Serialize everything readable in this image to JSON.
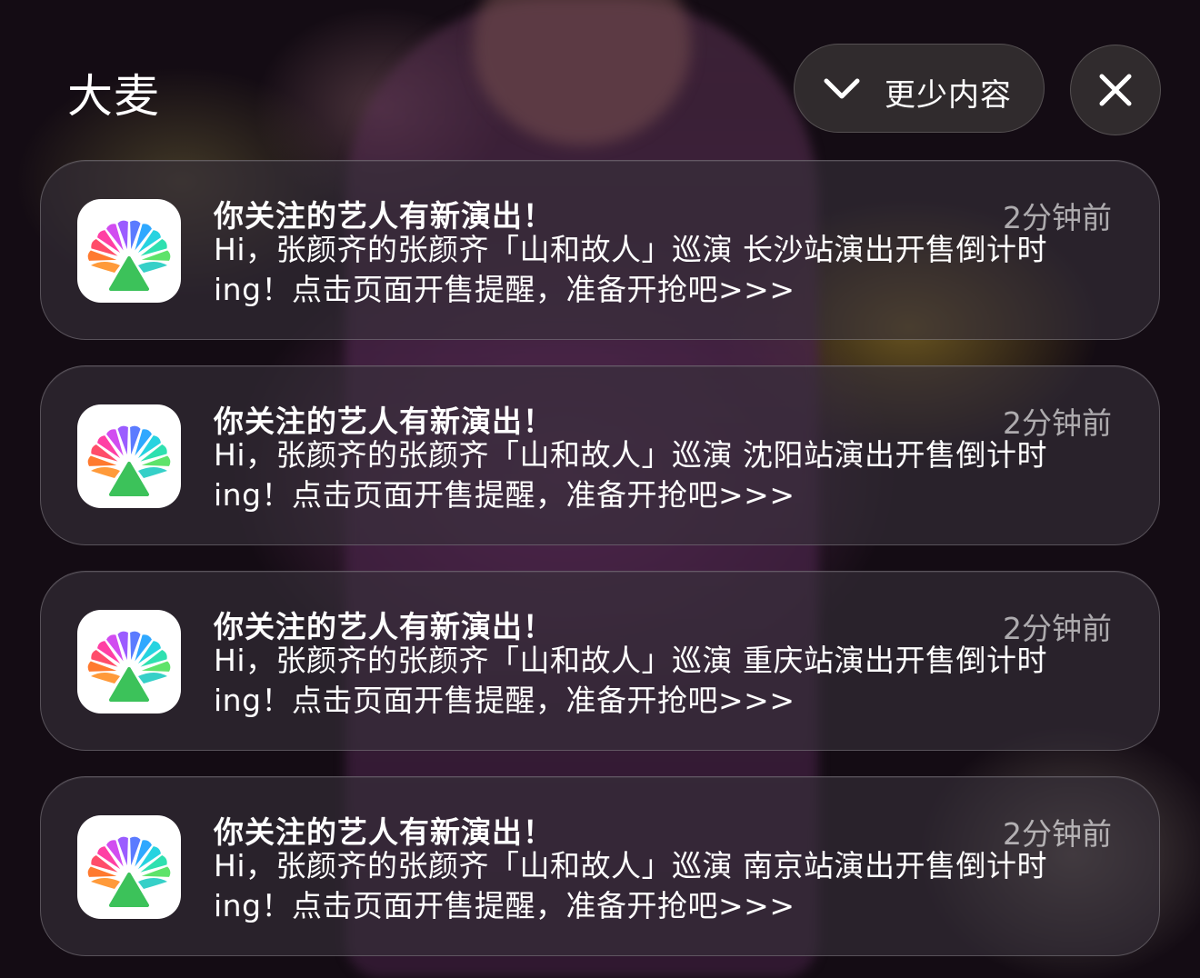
{
  "header": {
    "app_name": "大麦",
    "show_less_label": "更少内容",
    "show_less_icon": "chevron-down-icon",
    "close_icon": "close-icon"
  },
  "notifications": [
    {
      "title": "你关注的艺人有新演出！",
      "time": "2分钟前",
      "body_line1": "Hi，张颜齐的张颜齐「山和故人」巡演 长沙站演出开售倒计时",
      "body_line2": "ing！点击页面开售提醒，准备开抢吧>>>"
    },
    {
      "title": "你关注的艺人有新演出！",
      "time": "2分钟前",
      "body_line1": "Hi，张颜齐的张颜齐「山和故人」巡演 沈阳站演出开售倒计时",
      "body_line2": "ing！点击页面开售提醒，准备开抢吧>>>"
    },
    {
      "title": "你关注的艺人有新演出！",
      "time": "2分钟前",
      "body_line1": "Hi，张颜齐的张颜齐「山和故人」巡演 重庆站演出开售倒计时",
      "body_line2": "ing！点击页面开售提醒，准备开抢吧>>>"
    },
    {
      "title": "你关注的艺人有新演出！",
      "time": "2分钟前",
      "body_line1": "Hi，张颜齐的张颜齐「山和故人」巡演 南京站演出开售倒计时",
      "body_line2": "ing！点击页面开售提醒，准备开抢吧>>>"
    }
  ],
  "app_icon": "damai-app-icon"
}
